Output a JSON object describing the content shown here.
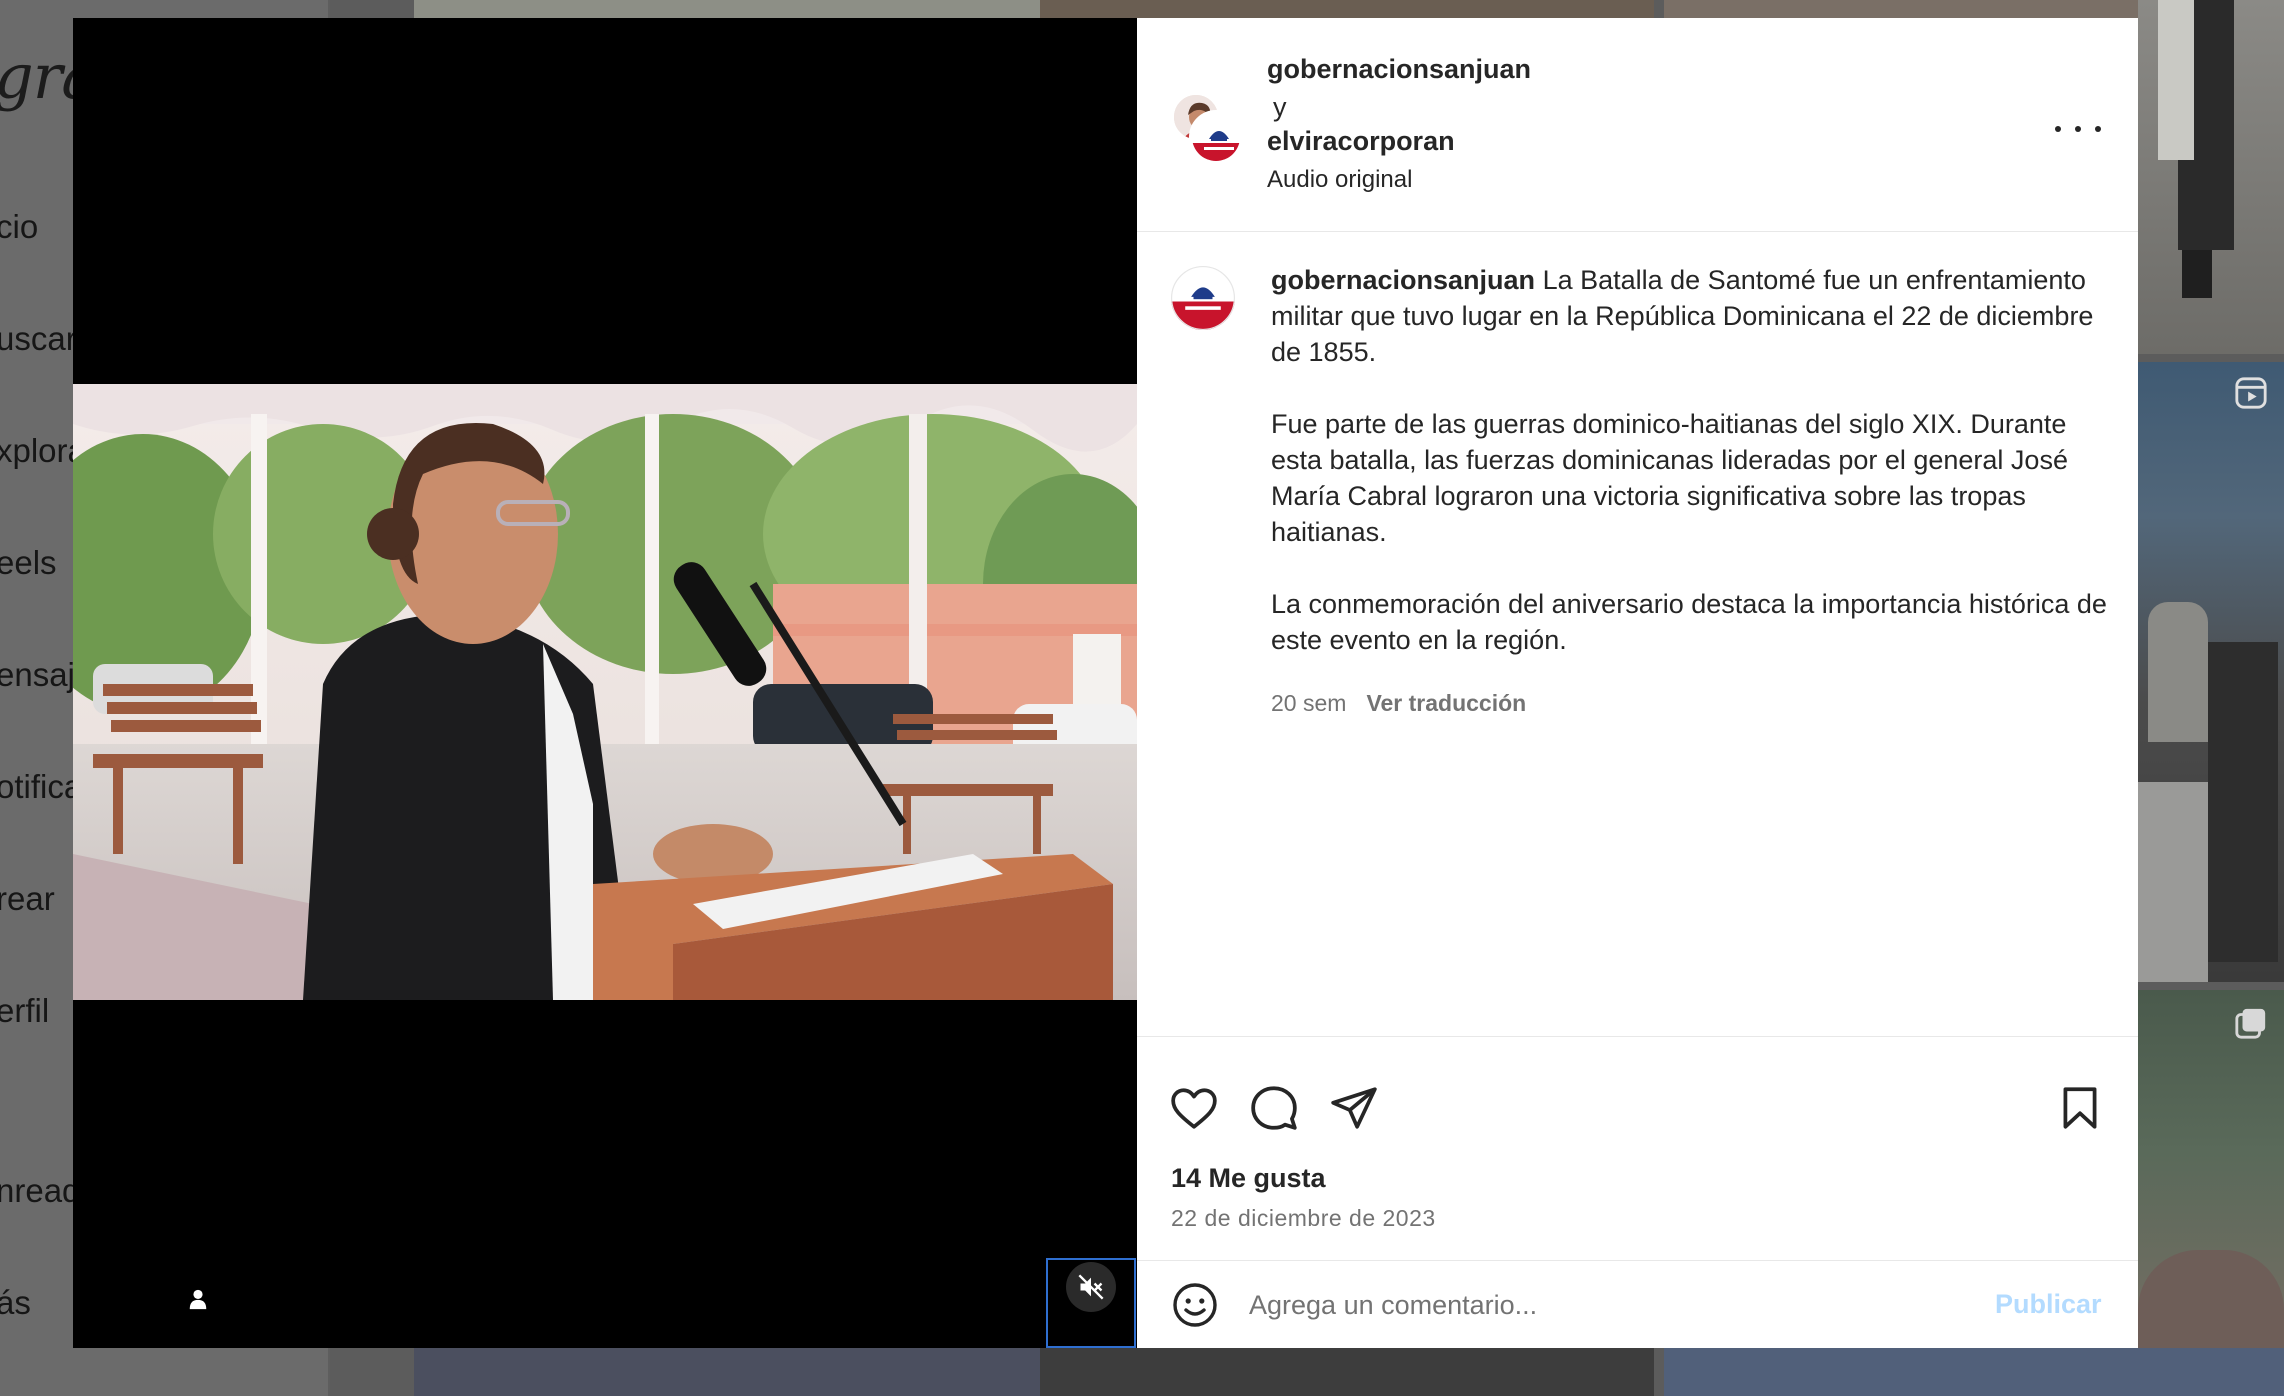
{
  "background": {
    "logo_fragment": "gram",
    "nav_fragments": [
      "cio",
      "uscar",
      "xplora",
      "eels",
      "ensaj",
      "otifica",
      "rear",
      "erfil",
      "nreads",
      "ás"
    ]
  },
  "post": {
    "author_primary": "gobernacionsanjuan",
    "author_joiner": "y",
    "author_secondary": "elviracorporan",
    "audio_label": "Audio original",
    "caption_user": "gobernacionsanjuan",
    "caption_paragraphs": [
      "La Batalla de Santomé fue un enfrentamiento militar que tuvo lugar en la República Dominicana el 22 de diciembre de 1855.",
      "Fue parte de las guerras dominico-haitianas del siglo XIX. Durante esta batalla, las fuerzas dominicanas lideradas por el general José María Cabral lograron una victoria significativa sobre las tropas haitianas.",
      "La conmemoración del aniversario destaca la importancia histórica de este evento en la región."
    ],
    "age": "20 sem",
    "translate_label": "Ver traducción",
    "likes": "14 Me gusta",
    "date": "22 de diciembre de 2023"
  },
  "comment": {
    "placeholder": "Agrega un comentario...",
    "publish_label": "Publicar"
  },
  "icons": {
    "tag": "user-tag-icon",
    "mute": "speaker-muted-icon",
    "more": "more-options-icon",
    "like": "heart-icon",
    "comment": "comment-bubble-icon",
    "share": "paper-plane-icon",
    "save": "bookmark-icon",
    "emoji": "smiley-icon"
  },
  "colors": {
    "publish_disabled": "#b3dbff",
    "text_primary": "#262626",
    "text_secondary": "#737373",
    "mute_focus_border": "#2f6fd0"
  }
}
